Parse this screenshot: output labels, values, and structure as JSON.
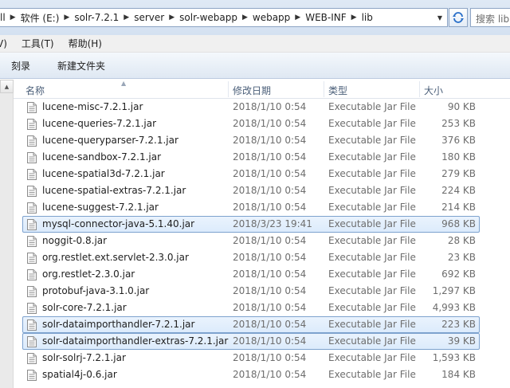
{
  "address": {
    "crumbs": [
      "软件 (E:)",
      "solr-7.2.1",
      "server",
      "solr-webapp",
      "webapp",
      "WEB-INF",
      "lib"
    ],
    "left_fragment": "ll",
    "search_placeholder": "搜索 lib"
  },
  "menu": {
    "items": [
      "V)",
      "工具(T)",
      "帮助(H)"
    ]
  },
  "toolbar": {
    "burn_label": "刻录",
    "new_folder_label": "新建文件夹"
  },
  "columns": {
    "name": "名称",
    "date": "修改日期",
    "type": "类型",
    "size": "大小"
  },
  "files": [
    {
      "name": "lucene-misc-7.2.1.jar",
      "date": "2018/1/10 0:54",
      "type": "Executable Jar File",
      "size": "90 KB",
      "selected": false
    },
    {
      "name": "lucene-queries-7.2.1.jar",
      "date": "2018/1/10 0:54",
      "type": "Executable Jar File",
      "size": "253 KB",
      "selected": false
    },
    {
      "name": "lucene-queryparser-7.2.1.jar",
      "date": "2018/1/10 0:54",
      "type": "Executable Jar File",
      "size": "376 KB",
      "selected": false
    },
    {
      "name": "lucene-sandbox-7.2.1.jar",
      "date": "2018/1/10 0:54",
      "type": "Executable Jar File",
      "size": "180 KB",
      "selected": false
    },
    {
      "name": "lucene-spatial3d-7.2.1.jar",
      "date": "2018/1/10 0:54",
      "type": "Executable Jar File",
      "size": "279 KB",
      "selected": false
    },
    {
      "name": "lucene-spatial-extras-7.2.1.jar",
      "date": "2018/1/10 0:54",
      "type": "Executable Jar File",
      "size": "224 KB",
      "selected": false
    },
    {
      "name": "lucene-suggest-7.2.1.jar",
      "date": "2018/1/10 0:54",
      "type": "Executable Jar File",
      "size": "214 KB",
      "selected": false
    },
    {
      "name": "mysql-connector-java-5.1.40.jar",
      "date": "2018/3/23 19:41",
      "type": "Executable Jar File",
      "size": "968 KB",
      "selected": true
    },
    {
      "name": "noggit-0.8.jar",
      "date": "2018/1/10 0:54",
      "type": "Executable Jar File",
      "size": "28 KB",
      "selected": false
    },
    {
      "name": "org.restlet.ext.servlet-2.3.0.jar",
      "date": "2018/1/10 0:54",
      "type": "Executable Jar File",
      "size": "23 KB",
      "selected": false
    },
    {
      "name": "org.restlet-2.3.0.jar",
      "date": "2018/1/10 0:54",
      "type": "Executable Jar File",
      "size": "692 KB",
      "selected": false
    },
    {
      "name": "protobuf-java-3.1.0.jar",
      "date": "2018/1/10 0:54",
      "type": "Executable Jar File",
      "size": "1,297 KB",
      "selected": false
    },
    {
      "name": "solr-core-7.2.1.jar",
      "date": "2018/1/10 0:54",
      "type": "Executable Jar File",
      "size": "4,993 KB",
      "selected": false
    },
    {
      "name": "solr-dataimporthandler-7.2.1.jar",
      "date": "2018/1/10 0:54",
      "type": "Executable Jar File",
      "size": "223 KB",
      "selected": true
    },
    {
      "name": "solr-dataimporthandler-extras-7.2.1.jar",
      "date": "2018/1/10 0:54",
      "type": "Executable Jar File",
      "size": "39 KB",
      "selected": true
    },
    {
      "name": "solr-solrj-7.2.1.jar",
      "date": "2018/1/10 0:54",
      "type": "Executable Jar File",
      "size": "1,593 KB",
      "selected": false
    },
    {
      "name": "spatial4j-0.6.jar",
      "date": "2018/1/10 0:54",
      "type": "Executable Jar File",
      "size": "184 KB",
      "selected": false
    }
  ]
}
